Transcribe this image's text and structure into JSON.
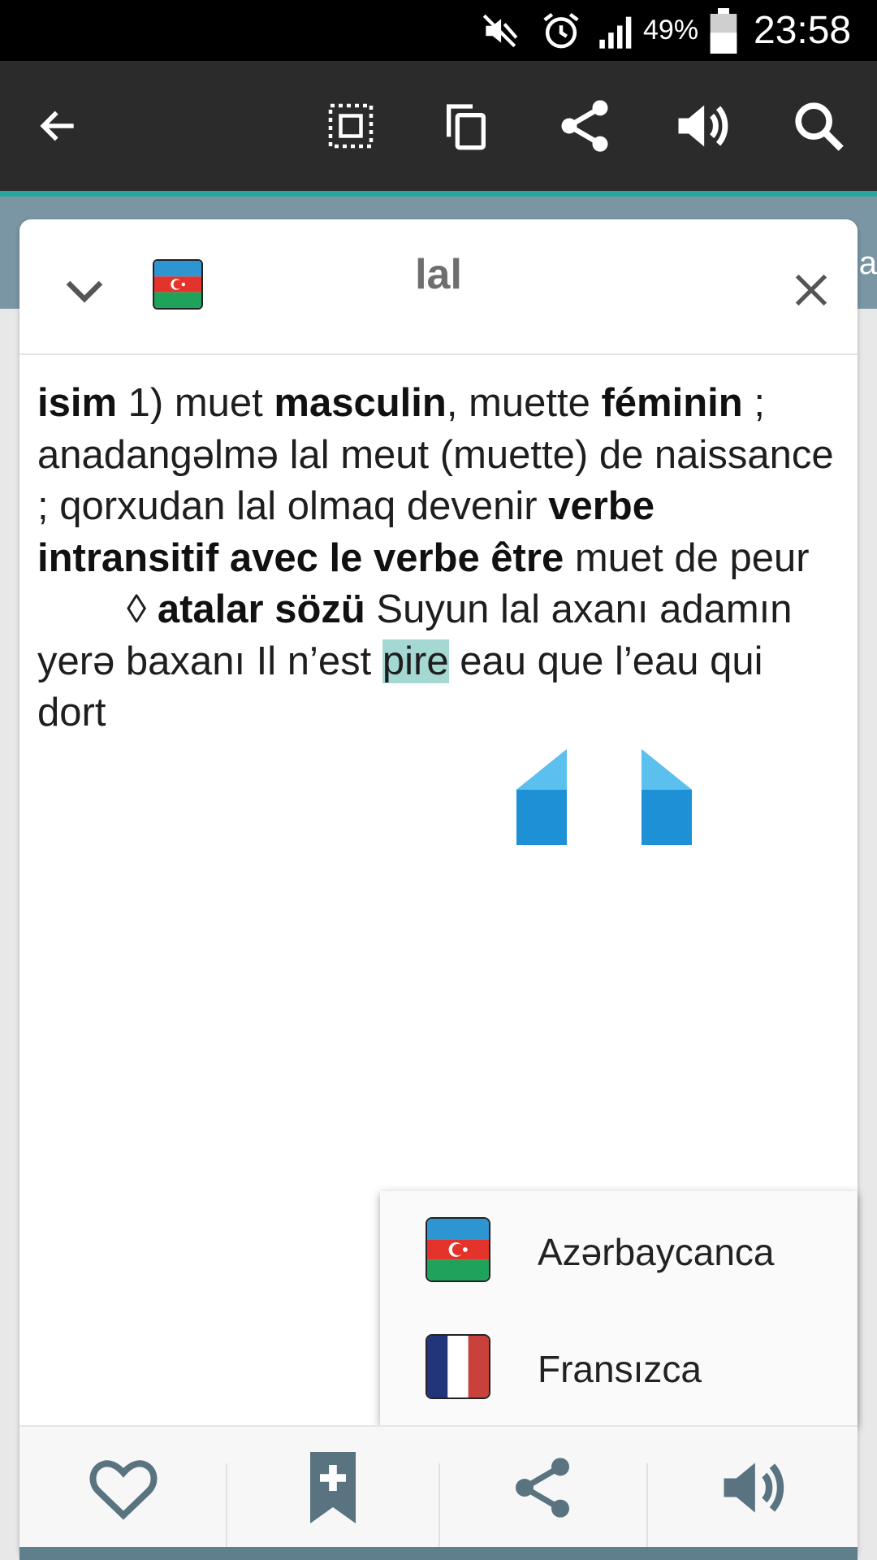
{
  "status_bar": {
    "battery_percent": "49%",
    "time": "23:58",
    "icons": [
      "mute-icon",
      "alarm-icon",
      "signal-icon",
      "battery-icon"
    ]
  },
  "action_bar": {
    "icons": [
      "back-arrow-icon",
      "select-all-icon",
      "copy-icon",
      "share-icon",
      "speaker-icon",
      "search-icon"
    ],
    "peek_text": "na"
  },
  "card": {
    "headword": "lal",
    "source_flag": "azerbaijan-flag-icon",
    "entry": {
      "s1": "isim",
      "s2": " 1) muet ",
      "s3": "masculin",
      "s4": ", muette ",
      "s5": "féminin",
      "s6": " ; anadangəlmə lal meut (muette) de naissance ; qorxudan lal olmaq devenir ",
      "s7": "verbe intransitif avec le verbe être",
      "s8": " muet de peur",
      "s9": "◊ ",
      "s10": "atalar sözü",
      "s11": " Suyun lal axanı adamın yerə baxanı Il n’est ",
      "selected": "pire",
      "s12": " eau que l’eau qui dort"
    }
  },
  "language_menu": {
    "items": [
      {
        "label": "Azərbaycanca",
        "flag": "azerbaijan-flag-icon"
      },
      {
        "label": "Fransızca",
        "flag": "france-flag-icon"
      }
    ]
  },
  "bottom_bar": {
    "icons": [
      "favorite-heart-icon",
      "bookmark-add-icon",
      "share-icon",
      "speaker-icon"
    ]
  },
  "colors": {
    "status_bar": "#000000",
    "action_bar": "#2b2b2b",
    "accent_teal": "#2aa6a0",
    "selection": "#a6d8d3",
    "handle_blue": "#1e90d6",
    "icon_slate": "#5a7380"
  }
}
